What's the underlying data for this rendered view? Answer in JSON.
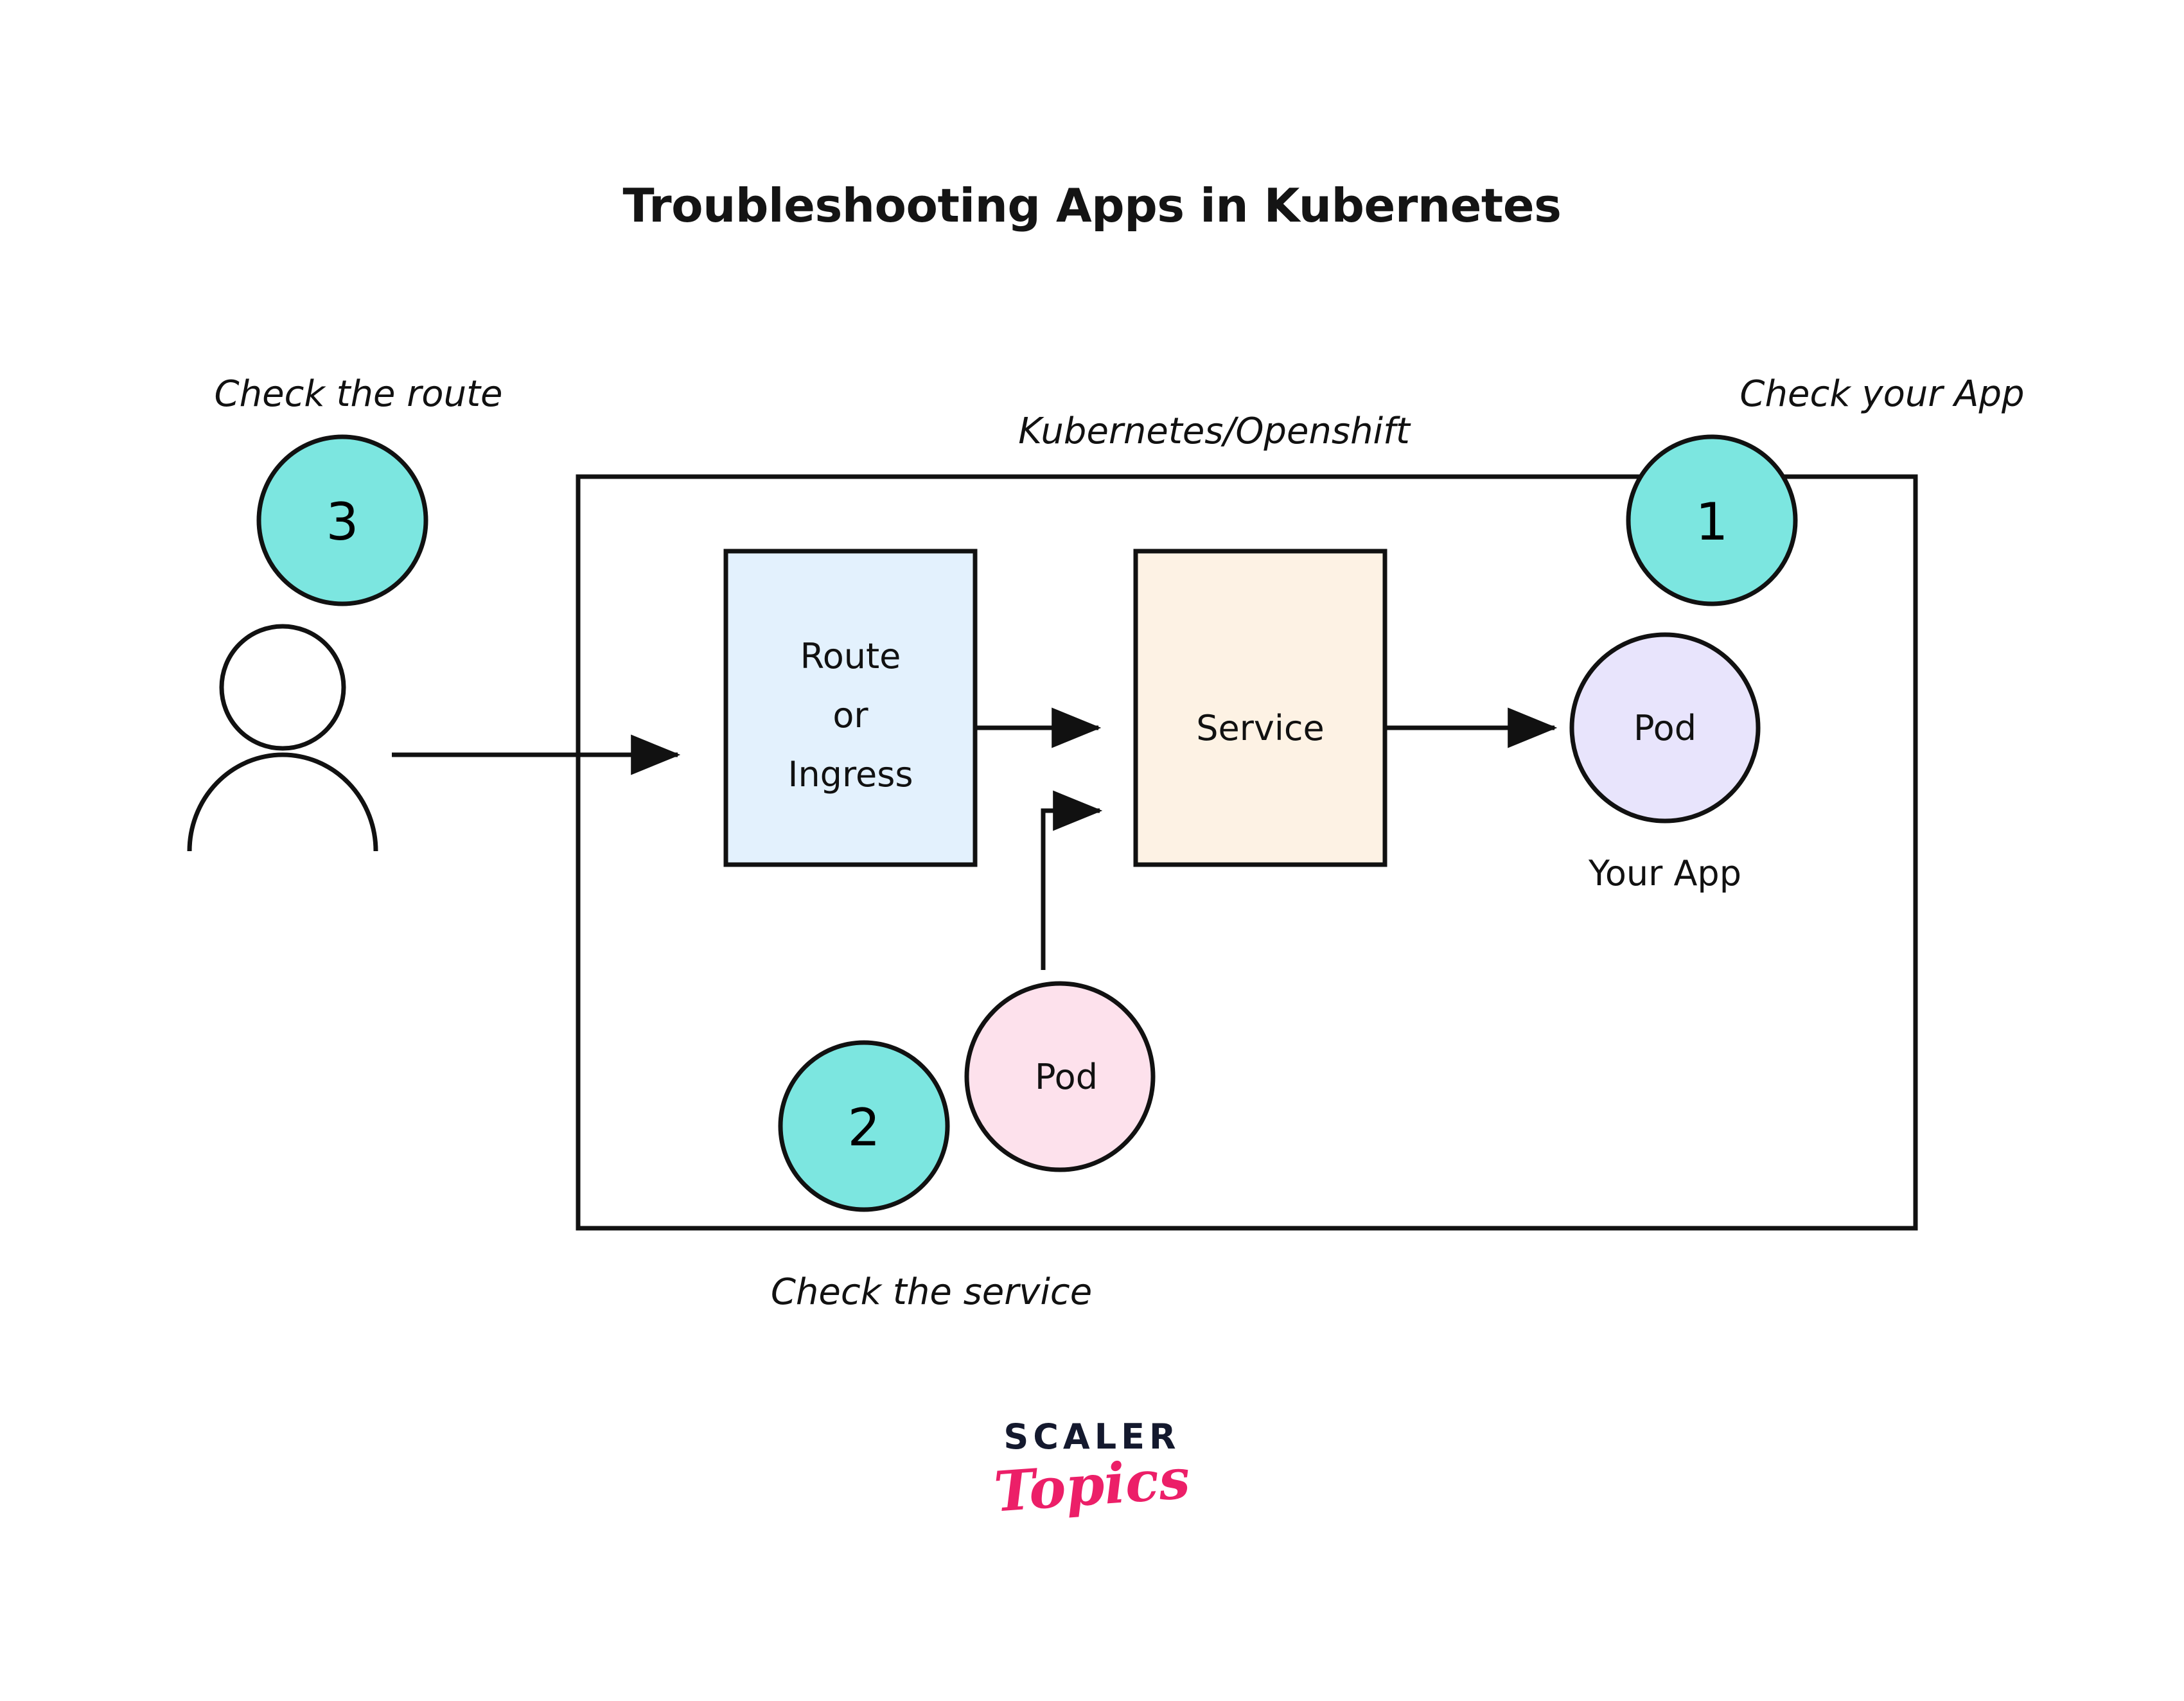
{
  "page": {
    "title": "Troubleshooting Apps in Kubernetes",
    "background": "#ffffff"
  },
  "diagram": {
    "boundary_label": "Kubernetes/Openshift",
    "annotations": {
      "check_route": "Check the route",
      "check_app": "Check your App",
      "check_service": "Check the service"
    },
    "steps": [
      {
        "id": "step-1",
        "number": "1",
        "caption": "Check your App",
        "color": "#7ce6e0"
      },
      {
        "id": "step-2",
        "number": "2",
        "caption": "Check the service",
        "color": "#7ce6e0"
      },
      {
        "id": "step-3",
        "number": "3",
        "caption": "Check the route",
        "color": "#7ce6e0"
      }
    ],
    "nodes": [
      {
        "id": "user",
        "label": "",
        "shape": "person",
        "color": "#ffffff"
      },
      {
        "id": "route-ingress",
        "label_line1": "Route",
        "label_line2": "or",
        "label_line3": "Ingress",
        "shape": "rect",
        "color": "#e3f1fd"
      },
      {
        "id": "service",
        "label": "Service",
        "shape": "rect",
        "color": "#fdf2e4"
      },
      {
        "id": "pod-app",
        "label": "Pod",
        "shape": "circle",
        "color": "#e8e4fc",
        "caption": "Your App"
      },
      {
        "id": "pod-service",
        "label": "Pod",
        "shape": "circle",
        "color": "#fde1ec"
      }
    ],
    "captions": {
      "your_app": "Your App"
    },
    "colors": {
      "stroke": "#111111",
      "teal": "#7ce6e0",
      "light_blue": "#e3f1fd",
      "cream": "#fdf2e4",
      "lavender": "#e8e4fc",
      "pink": "#fde1ec"
    }
  },
  "logo": {
    "primary": "SCALER",
    "secondary": "Topics",
    "primary_color": "#14192e",
    "secondary_color": "#ec1f68"
  }
}
